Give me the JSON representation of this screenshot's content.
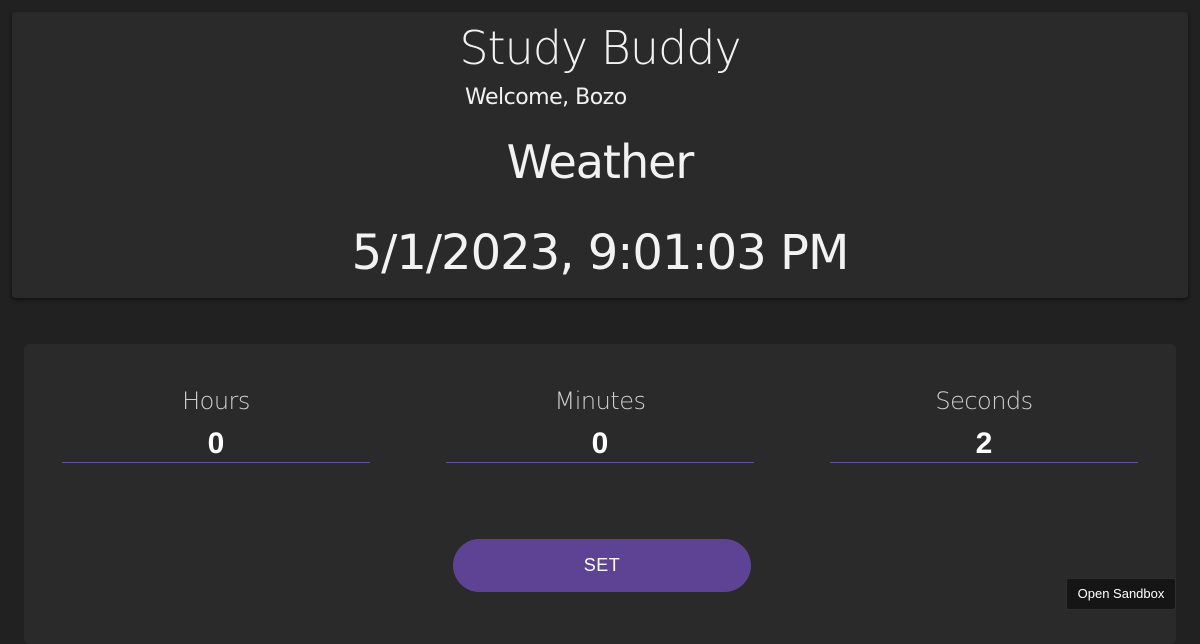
{
  "header": {
    "app_title": "Study Buddy",
    "welcome": "Welcome, Bozo",
    "weather": "Weather",
    "datetime": "5/1/2023, 9:01:03 PM"
  },
  "timer": {
    "hours": {
      "label": "Hours",
      "value": "0"
    },
    "minutes": {
      "label": "Minutes",
      "value": "0"
    },
    "seconds": {
      "label": "Seconds",
      "value": "2"
    },
    "set_label": "SET"
  },
  "sandbox": {
    "label": "Open Sandbox"
  },
  "colors": {
    "background": "#212121",
    "card": "#2a2a2a",
    "accent": "#5e4394",
    "underline": "#6a4fa0"
  }
}
